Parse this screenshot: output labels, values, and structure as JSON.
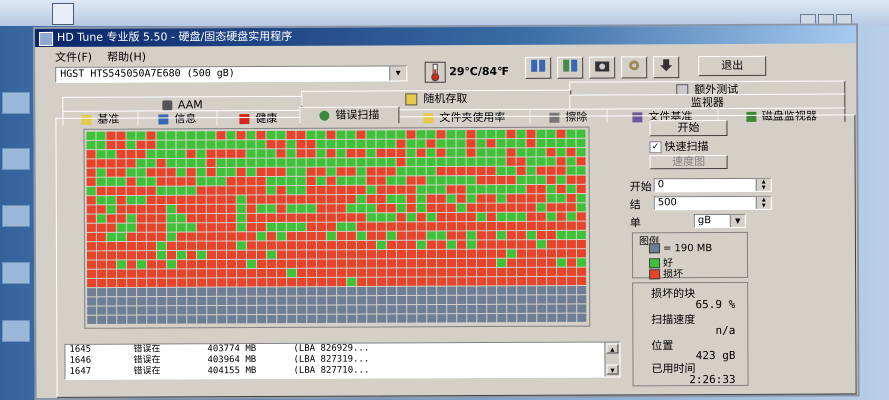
{
  "window": {
    "title": "HD Tune 专业版 5.50 - 硬盘/固态硬盘实用程序"
  },
  "menu": {
    "file": "文件(F)",
    "help": "帮助(H)"
  },
  "toolbar": {
    "drive": "HGST HTS545050A7E680 (500 gB)",
    "temperature": "29℃/84℉",
    "exit_label": "退出",
    "icons": [
      "copy-info-icon",
      "copy-screen-icon",
      "screenshot-icon",
      "options-icon",
      "down-arrow-icon"
    ]
  },
  "tabs": {
    "row1": [
      {
        "label": "额外测试",
        "icon": "extra-tests-icon"
      }
    ],
    "row2": [
      {
        "label": "AAM",
        "icon": "speaker-icon"
      },
      {
        "label": "随机存取",
        "icon": "random-access-icon"
      },
      {
        "label": "监视器"
      }
    ],
    "row3": [
      {
        "label": "基准",
        "icon": "benchmark-icon"
      },
      {
        "label": "信息",
        "icon": "info-icon"
      },
      {
        "label": "健康",
        "icon": "health-icon"
      },
      {
        "label": "错误扫描",
        "icon": "magnifier-icon"
      },
      {
        "label": "文件夹使用率",
        "icon": "folder-icon"
      },
      {
        "label": "擦除",
        "icon": "erase-icon"
      },
      {
        "label": "文件基准",
        "icon": "file-benchmark-icon"
      },
      {
        "label": "磁盘监视器",
        "icon": "disk-monitor-icon"
      }
    ]
  },
  "scan": {
    "damaged_percent": 65.9,
    "colors": {
      "good": "#3fc23a",
      "bad": "#e8442b",
      "unscanned": "#6e7f95"
    }
  },
  "log": [
    {
      "num": "1645",
      "msg": "错误在",
      "mb": "403774 MB",
      "lba": "(LBA 826929..."
    },
    {
      "num": "1646",
      "msg": "错误在",
      "mb": "403964 MB",
      "lba": "(LBA 827319..."
    },
    {
      "num": "1647",
      "msg": "错误在",
      "mb": "404155 MB",
      "lba": "(LBA 827710..."
    }
  ],
  "controls": {
    "start_button": "开始",
    "quick_scan_label": "快速扫描",
    "quick_scan_checked": "✓",
    "speed_map_button": "速度图",
    "start_label": "开始",
    "start_value": "0",
    "end_label": "结",
    "end_value": "500",
    "unit_label": "单",
    "unit_value": "gB"
  },
  "legend": {
    "title": "图例",
    "block_size": "= 190 MB",
    "good": "好",
    "bad": "损坏"
  },
  "stats": {
    "damaged_label": "损坏的块",
    "damaged_value": "65.9 %",
    "scan_speed_label": "扫描速度",
    "scan_speed_value": "n/a",
    "position_label": "位置",
    "position_value": "423 gB",
    "elapsed_label": "已用时间",
    "elapsed_value": "2:26:33"
  }
}
